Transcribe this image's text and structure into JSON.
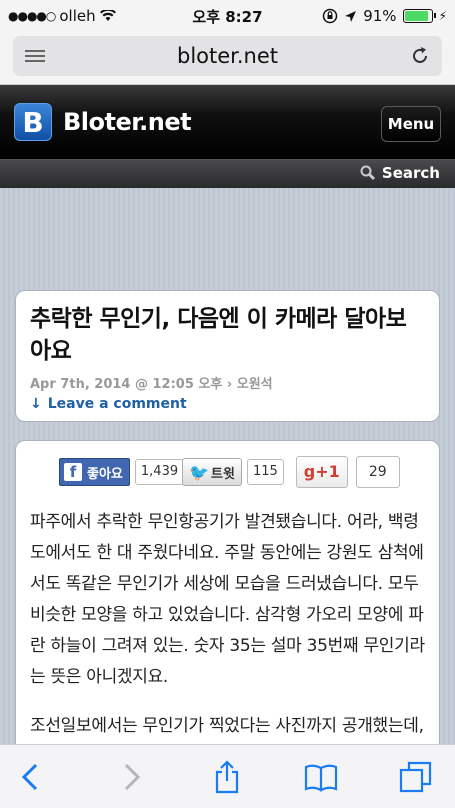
{
  "status": {
    "carrier": "olleh",
    "time": "오후 8:27",
    "battery_percent": "91%",
    "battery_level": 0.91
  },
  "browser": {
    "url": "bloter.net"
  },
  "site": {
    "logo_letter": "B",
    "name": "Bloter.net",
    "menu_label": "Menu",
    "search_label": "Search"
  },
  "post": {
    "title": "추락한 무인기, 다음엔 이 카메라 달아보아요",
    "meta": "Apr 7th, 2014 @ 12:05 오후 › 오원석",
    "comment_link": "Leave a comment"
  },
  "social": {
    "facebook_label": "좋아요",
    "facebook_count": "1,439",
    "twitter_label": "트윗",
    "twitter_count": "115",
    "gplus_label": "g+1",
    "gplus_count": "29"
  },
  "article": {
    "paragraphs": [
      "파주에서 추락한 무인항공기가 발견됐습니다. 어라, 백령도에서도 한 대 주웠다네요. 주말 동안에는 강원도 삼척에서도 똑같은 무인기가 세상에 모습을 드러냈습니다. 모두 비슷한 모양을 하고 있었습니다. 삼각형 가오리 모양에 파란 하늘이 그려져 있는. 숫자 35는 설마 35번째 무인기라는 뜻은 아니겠지요.",
      "조선일보에서는 무인기가 찍었다는 사진까지 공개했는데, 오리니가 청와대가 떡하니 찍혀 있었죠 뭐"
    ]
  }
}
